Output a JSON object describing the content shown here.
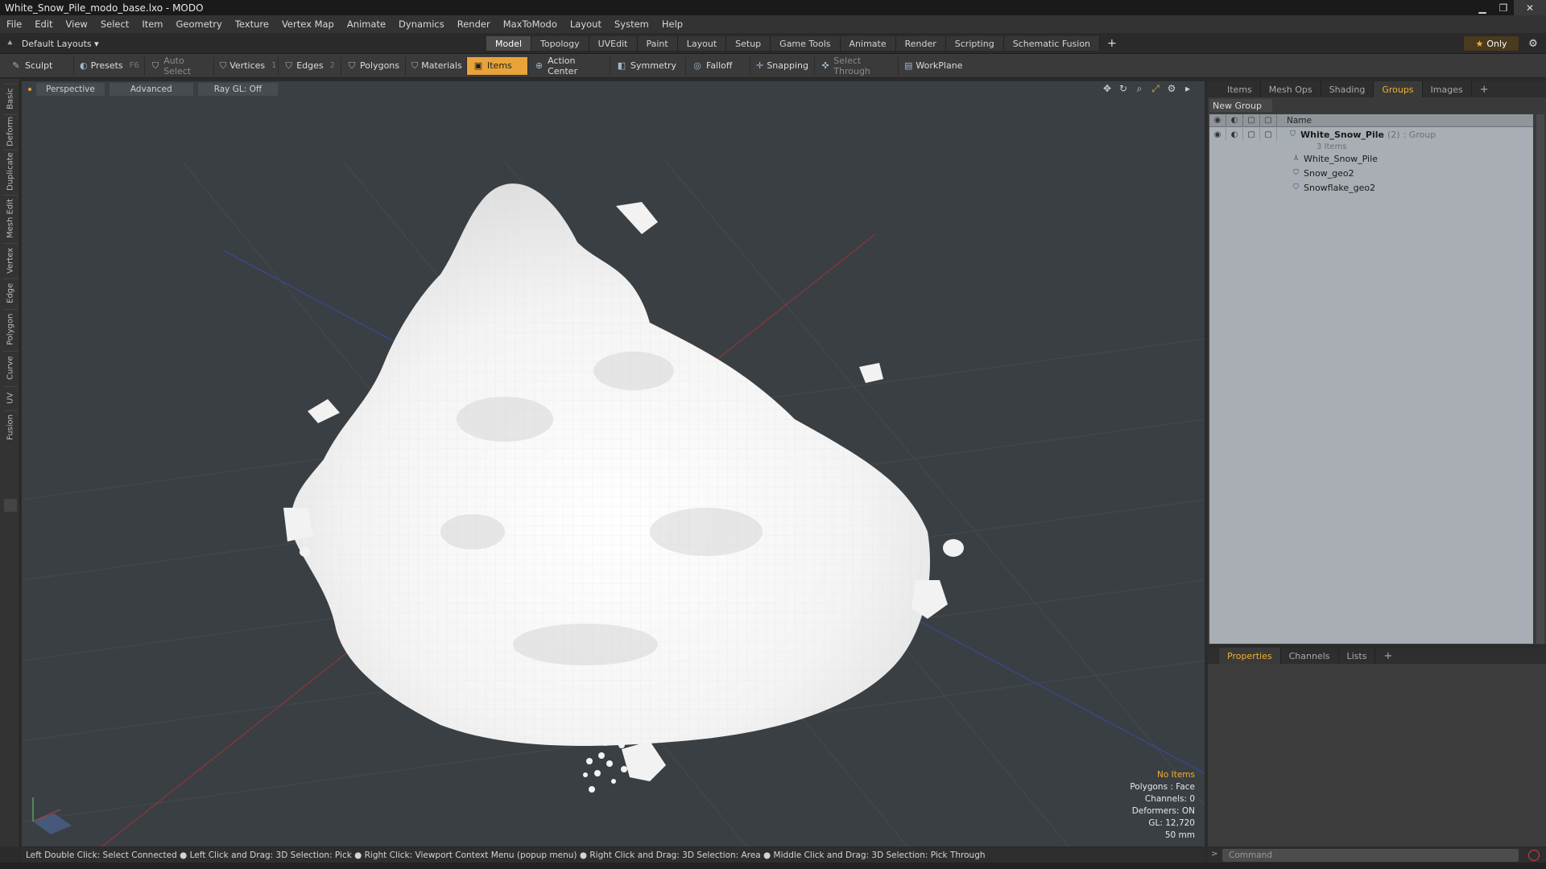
{
  "window": {
    "title": "White_Snow_Pile_modo_base.lxo - MODO",
    "minimize": "▁",
    "maximize": "❐",
    "close": "✕"
  },
  "menu": [
    "File",
    "Edit",
    "View",
    "Select",
    "Item",
    "Geometry",
    "Texture",
    "Vertex Map",
    "Animate",
    "Dynamics",
    "Render",
    "MaxToModo",
    "Layout",
    "System",
    "Help"
  ],
  "layout_selector": {
    "label": "Default Layouts ▾"
  },
  "mode_tabs": [
    "Model",
    "Topology",
    "UVEdit",
    "Paint",
    "Layout",
    "Setup",
    "Game Tools",
    "Animate",
    "Render",
    "Scripting",
    "Schematic Fusion"
  ],
  "active_mode_tab": "Model",
  "only_button": {
    "label": "Only"
  },
  "toolbar": {
    "sculpt": "Sculpt",
    "presets": "Presets",
    "presets_key": "F6",
    "auto_select": "Auto Select",
    "vertices": "Vertices",
    "vertices_count": "1",
    "edges": "Edges",
    "edges_count": "2",
    "polygons": "Polygons",
    "materials": "Materials",
    "items": "Items",
    "action_center": "Action Center",
    "symmetry": "Symmetry",
    "falloff": "Falloff",
    "snapping": "Snapping",
    "select_through": "Select Through",
    "workplane": "WorkPlane"
  },
  "left_tabs": [
    "Basic",
    "Deform",
    "Duplicate",
    "Mesh Edit",
    "Vertex",
    "Edge",
    "Polygon",
    "Curve",
    "UV",
    "Fusion"
  ],
  "viewport": {
    "view": "Perspective",
    "shading": "Advanced",
    "raygl": "Ray GL: Off",
    "stats": {
      "selection": "No Items",
      "polygons": "Polygons : Face",
      "channels": "Channels: 0",
      "deformers": "Deformers: ON",
      "gl": "GL: 12,720",
      "units": "50 mm"
    }
  },
  "status_hint": "Left Double Click: Select Connected ● Left Click and Drag: 3D Selection: Pick ● Right Click: Viewport Context Menu (popup menu) ● Right Click and Drag: 3D Selection: Area ● Middle Click and Drag: 3D Selection: Pick Through",
  "right_panel": {
    "tabs": [
      "Items",
      "Mesh Ops",
      "Shading",
      "Groups",
      "Images"
    ],
    "active_tab": "Groups",
    "new_group": "New Group",
    "column_name": "Name",
    "group": {
      "name": "White_Snow_Pile",
      "count": "(2)",
      "type": ": Group",
      "sub": "3 Items"
    },
    "children": [
      "White_Snow_Pile",
      "Snow_geo2",
      "Snowflake_geo2"
    ]
  },
  "bottom_panel": {
    "tabs": [
      "Properties",
      "Channels",
      "Lists"
    ],
    "active_tab": "Properties"
  },
  "command": {
    "placeholder": "Command"
  },
  "colors": {
    "accent": "#e8a33a",
    "viewport_bg": "#3a3f44",
    "tree_bg": "#a8aeb4"
  }
}
